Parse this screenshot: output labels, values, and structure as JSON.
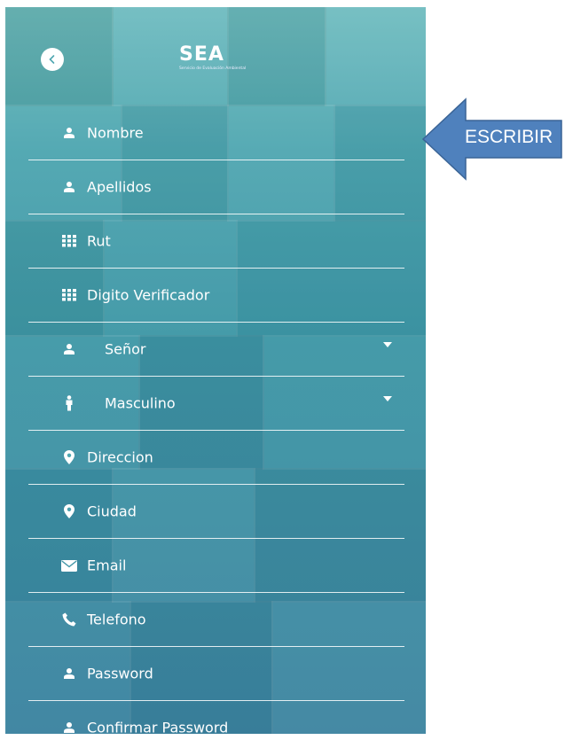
{
  "header": {
    "logo_text": "SEA",
    "logo_subtitle": "Servicio de Evaluación Ambiental"
  },
  "fields": [
    {
      "label": "Nombre",
      "icon": "user-icon"
    },
    {
      "label": "Apellidos",
      "icon": "user-icon"
    },
    {
      "label": "Rut",
      "icon": "keypad-icon"
    },
    {
      "label": "Digito Verificador",
      "icon": "keypad-icon"
    },
    {
      "label": "Señor",
      "icon": "user-icon",
      "type": "select"
    },
    {
      "label": "Masculino",
      "icon": "male-icon",
      "type": "select"
    },
    {
      "label": "Direccion",
      "icon": "map-pin-icon"
    },
    {
      "label": "Ciudad",
      "icon": "map-pin-icon"
    },
    {
      "label": "Email",
      "icon": "envelope-icon"
    },
    {
      "label": "Telefono",
      "icon": "phone-icon"
    },
    {
      "label": "Password",
      "icon": "user-icon"
    },
    {
      "label": "Confirmar Password",
      "icon": "user-icon"
    }
  ],
  "callout": {
    "text": "ESCRIBIR",
    "color": "#4f81bd"
  }
}
